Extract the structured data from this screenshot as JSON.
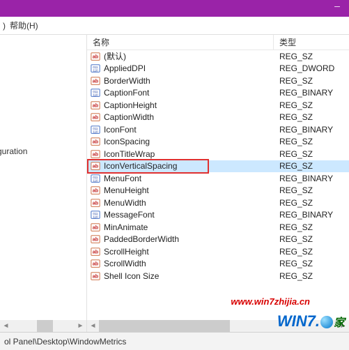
{
  "window": {
    "titlebar_color": "#9a23a8"
  },
  "menubar": {
    "partial_prefix": ")",
    "help": "帮助(H)"
  },
  "tree": {
    "visible_item": "guration"
  },
  "list": {
    "header_name": "名称",
    "header_type": "类型",
    "rows": [
      {
        "name": "(默认)",
        "type": "REG_SZ",
        "icon": "ab"
      },
      {
        "name": "AppliedDPI",
        "type": "REG_DWORD",
        "icon": "bin"
      },
      {
        "name": "BorderWidth",
        "type": "REG_SZ",
        "icon": "ab"
      },
      {
        "name": "CaptionFont",
        "type": "REG_BINARY",
        "icon": "bin"
      },
      {
        "name": "CaptionHeight",
        "type": "REG_SZ",
        "icon": "ab"
      },
      {
        "name": "CaptionWidth",
        "type": "REG_SZ",
        "icon": "ab"
      },
      {
        "name": "IconFont",
        "type": "REG_BINARY",
        "icon": "bin"
      },
      {
        "name": "IconSpacing",
        "type": "REG_SZ",
        "icon": "ab"
      },
      {
        "name": "IconTitleWrap",
        "type": "REG_SZ",
        "icon": "ab"
      },
      {
        "name": "IconVerticalSpacing",
        "type": "REG_SZ",
        "icon": "ab"
      },
      {
        "name": "MenuFont",
        "type": "REG_BINARY",
        "icon": "bin"
      },
      {
        "name": "MenuHeight",
        "type": "REG_SZ",
        "icon": "ab"
      },
      {
        "name": "MenuWidth",
        "type": "REG_SZ",
        "icon": "ab"
      },
      {
        "name": "MessageFont",
        "type": "REG_BINARY",
        "icon": "bin"
      },
      {
        "name": "MinAnimate",
        "type": "REG_SZ",
        "icon": "ab"
      },
      {
        "name": "PaddedBorderWidth",
        "type": "REG_SZ",
        "icon": "ab"
      },
      {
        "name": "ScrollHeight",
        "type": "REG_SZ",
        "icon": "ab"
      },
      {
        "name": "ScrollWidth",
        "type": "REG_SZ",
        "icon": "ab"
      },
      {
        "name": "Shell Icon Size",
        "type": "REG_SZ",
        "icon": "ab"
      }
    ],
    "selected_index": 9,
    "highlight_index": 9
  },
  "statusbar": {
    "path": "ol Panel\\Desktop\\WindowMetrics"
  },
  "watermark": {
    "url": "www.win7zhijia.cn",
    "logo_prefix": "WIN7.",
    "logo_suffix": "家"
  }
}
